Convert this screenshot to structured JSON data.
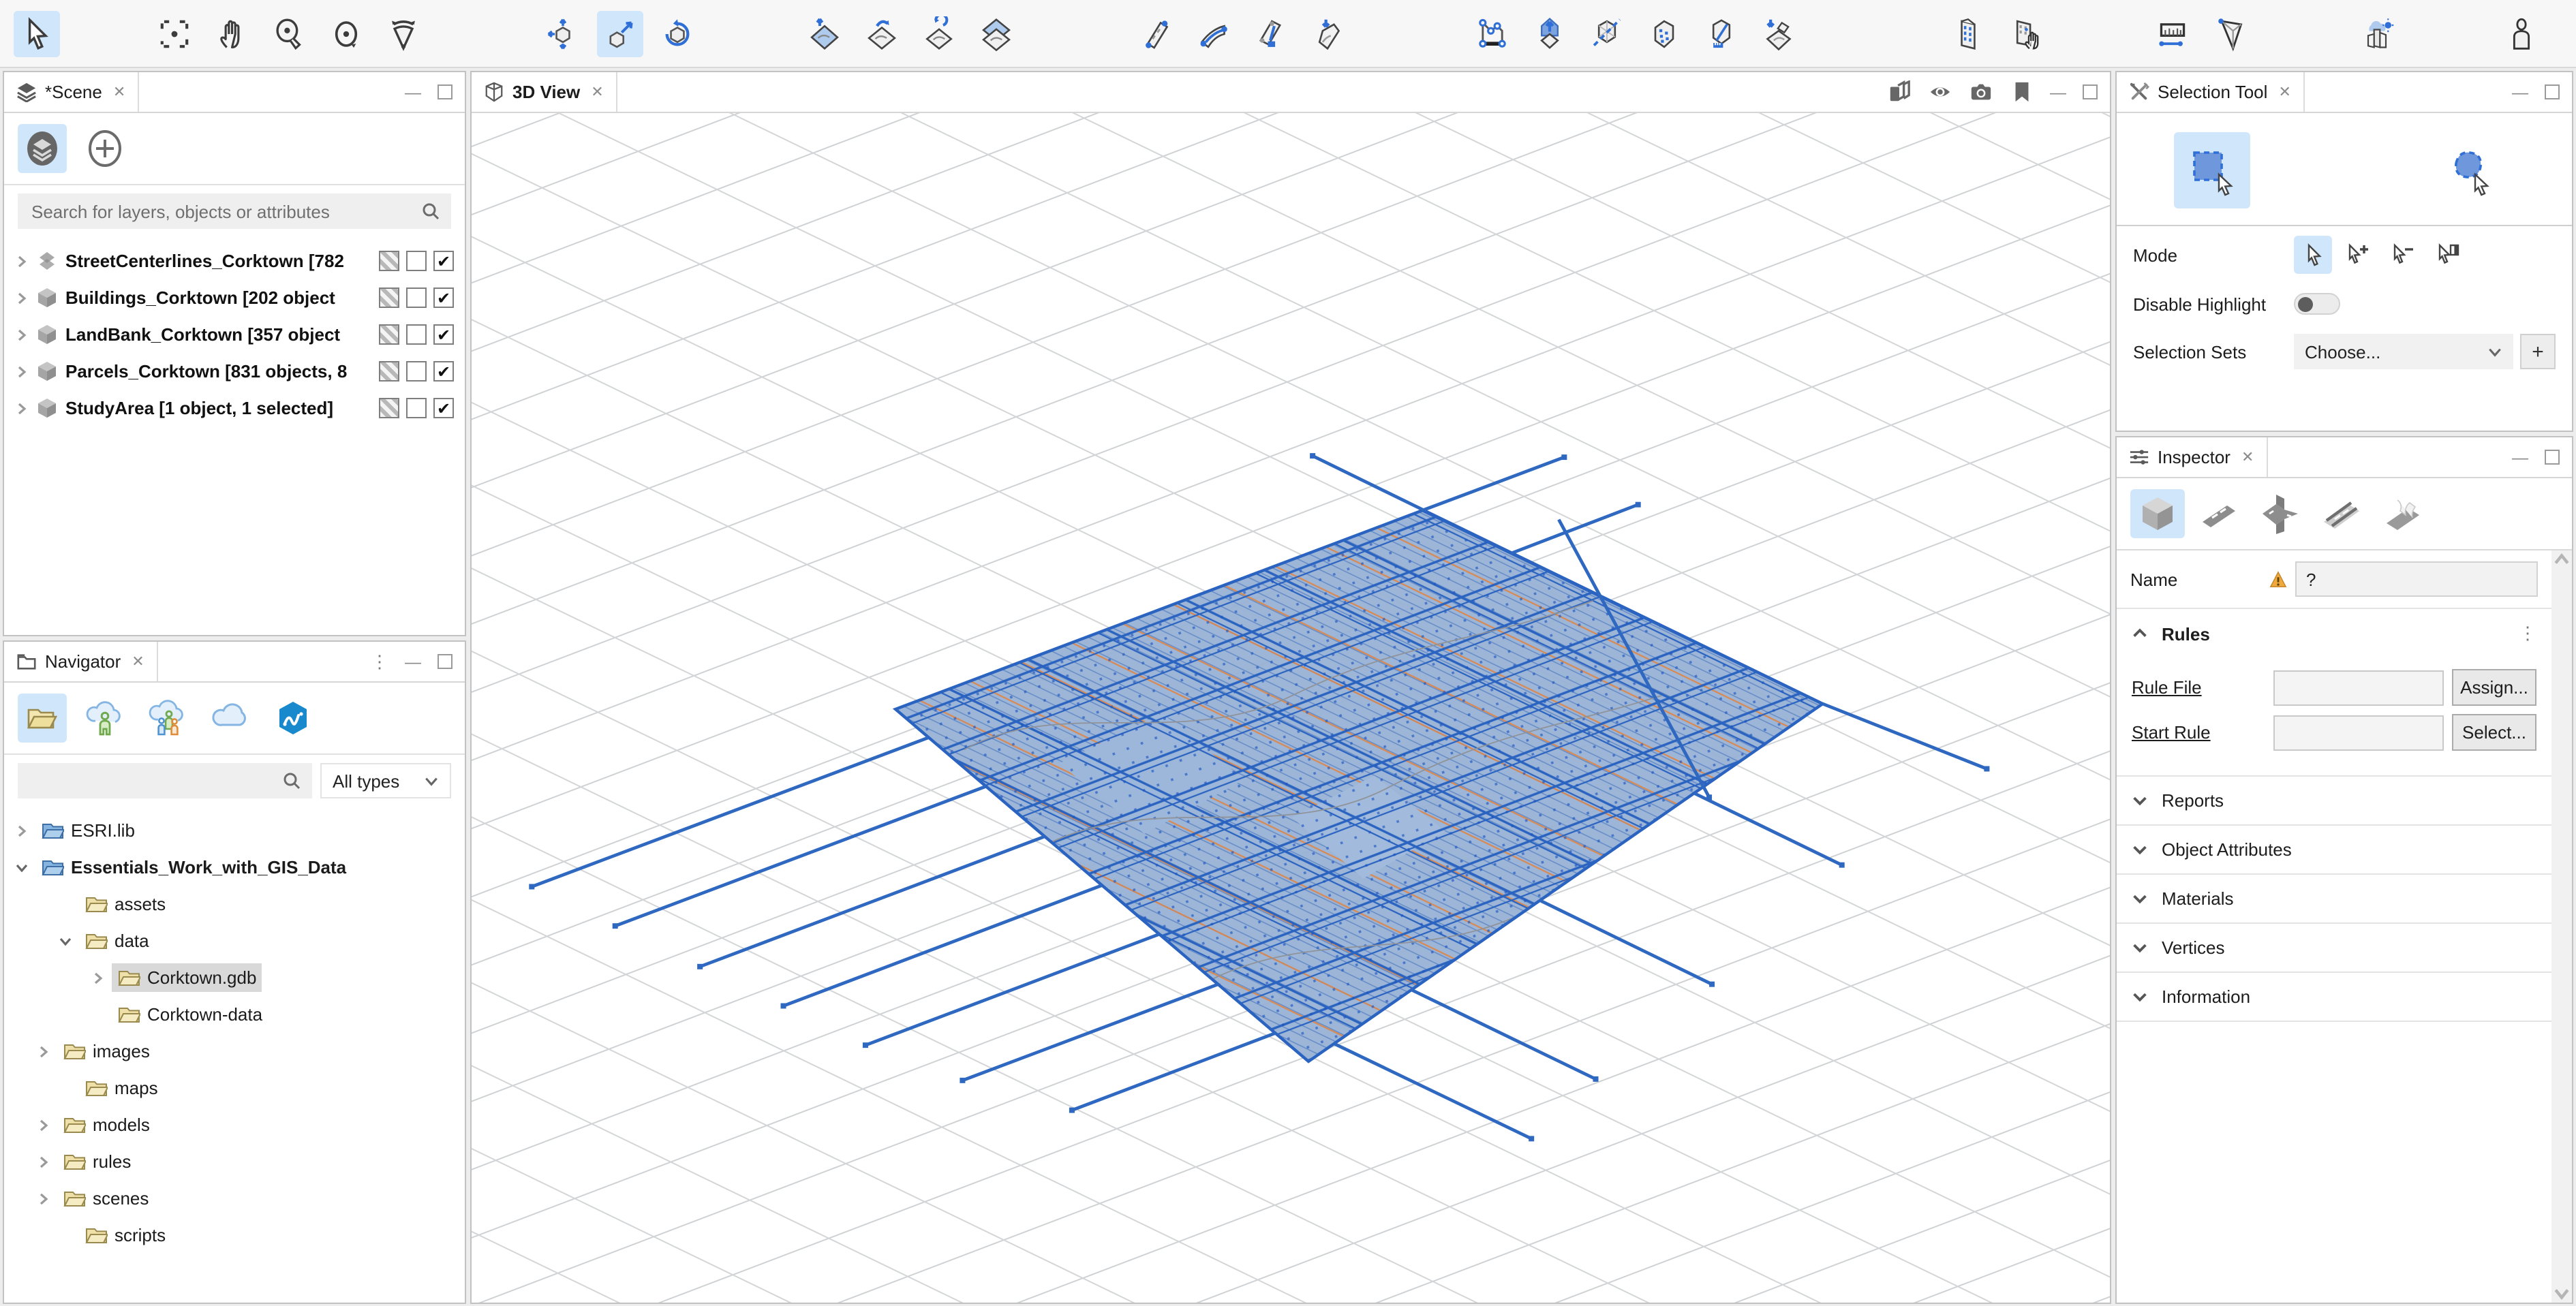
{
  "icons": {
    "close": "✕",
    "minimize": "—",
    "kebab": "⋮",
    "check": "✔",
    "plus": "+"
  },
  "scene": {
    "tab": "*Scene",
    "search_placeholder": "Search for layers, objects or attributes",
    "layers": [
      {
        "label": "StreetCenterlines_Corktown [782"
      },
      {
        "label": "Buildings_Corktown [202 object"
      },
      {
        "label": "LandBank_Corktown [357 object"
      },
      {
        "label": "Parcels_Corktown [831 objects, 8"
      },
      {
        "label": "StudyArea [1 object, 1 selected]"
      }
    ]
  },
  "navigator": {
    "tab": "Navigator",
    "filter_value": "All types",
    "tree": [
      {
        "label": "ESRI.lib"
      },
      {
        "label": "Essentials_Work_with_GIS_Data"
      },
      {
        "label": "assets"
      },
      {
        "label": "data"
      },
      {
        "label": "Corktown.gdb"
      },
      {
        "label": "Corktown-data"
      },
      {
        "label": "images"
      },
      {
        "label": "maps"
      },
      {
        "label": "models"
      },
      {
        "label": "rules"
      },
      {
        "label": "scenes"
      },
      {
        "label": "scripts"
      }
    ]
  },
  "view": {
    "tab": "3D View"
  },
  "selection_tool": {
    "tab": "Selection Tool",
    "mode_label": "Mode",
    "disable_highlight_label": "Disable Highlight",
    "selection_sets_label": "Selection Sets",
    "selection_sets_value": "Choose..."
  },
  "inspector": {
    "tab": "Inspector",
    "name_label": "Name",
    "name_value": "?",
    "rules_label": "Rules",
    "rule_file_label": "Rule File",
    "start_rule_label": "Start Rule",
    "assign_button": "Assign...",
    "select_button": "Select...",
    "sections": [
      {
        "label": "Reports"
      },
      {
        "label": "Object Attributes"
      },
      {
        "label": "Materials"
      },
      {
        "label": "Vertices"
      },
      {
        "label": "Information"
      }
    ]
  },
  "colors": {
    "accent_blue": "#2f6fd6",
    "selection_bg": "#cfe6fb",
    "map_fill": "#98b2d6",
    "street_blue": "#2a63c0",
    "lot_orange": "#e08443"
  }
}
